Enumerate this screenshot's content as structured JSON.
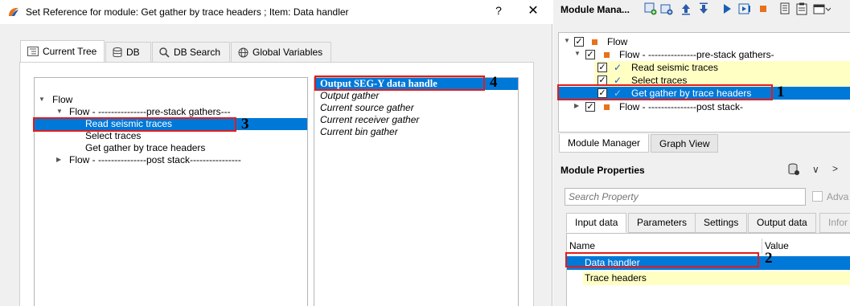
{
  "dialog": {
    "title": "Set Reference for module: Get gather by trace headers ; Item: Data handler",
    "help_glyph": "?",
    "close_glyph": "✕",
    "tabs": [
      {
        "label": "Current Tree",
        "icon": "tree-icon"
      },
      {
        "label": "DB",
        "icon": "database-icon"
      },
      {
        "label": "DB Search",
        "icon": "magnifier-icon"
      },
      {
        "label": "Global Variables",
        "icon": "globe-icon"
      }
    ],
    "tree": [
      {
        "label": "Flow"
      },
      {
        "label": "Flow - ---------------pre-stack gathers---"
      },
      {
        "label": "Read seismic traces",
        "selected": true
      },
      {
        "label": "Select traces"
      },
      {
        "label": "Get gather by trace headers"
      },
      {
        "label": "Flow - ---------------post stack----------------"
      }
    ],
    "handles": [
      {
        "label": "Output SEG-Y data handle",
        "selected": true
      },
      {
        "label": "Output gather"
      },
      {
        "label": "Current source gather"
      },
      {
        "label": "Current receiver gather"
      },
      {
        "label": "Current bin gather"
      }
    ]
  },
  "module_manager": {
    "title": "Module Mana...",
    "toolbar_icons": [
      "add-module-icon",
      "add-flow-icon",
      "move-up-icon",
      "move-down-icon",
      "run-icon",
      "step-icon",
      "stop-icon",
      "copy-icon",
      "paste-icon",
      "window-icon"
    ],
    "tree": [
      {
        "label": "Flow"
      },
      {
        "label": "Flow - ---------------pre-stack gathers-"
      },
      {
        "label": "Read seismic traces"
      },
      {
        "label": "Select traces"
      },
      {
        "label": "Get gather by trace headers",
        "selected": true
      },
      {
        "label": "Flow - ---------------post stack-"
      }
    ],
    "bottom_tabs": [
      "Module Manager",
      "Graph View"
    ]
  },
  "module_properties": {
    "title": "Module Properties",
    "search_placeholder": "Search Property",
    "advanced_label": "Adva",
    "tabs": [
      "Input data",
      "Parameters",
      "Settings",
      "Output data",
      "Infor"
    ],
    "columns": [
      "Name",
      "Value"
    ],
    "rows": [
      {
        "name": "Data handler",
        "selected": true
      },
      {
        "name": "Trace headers"
      }
    ]
  },
  "callouts": [
    "1",
    "2",
    "3",
    "4"
  ],
  "colors": {
    "selection": "#0078d7",
    "highlight_box": "#e21c1c",
    "module_square": "#e8711a",
    "yellow_row": "#ffffc4"
  }
}
